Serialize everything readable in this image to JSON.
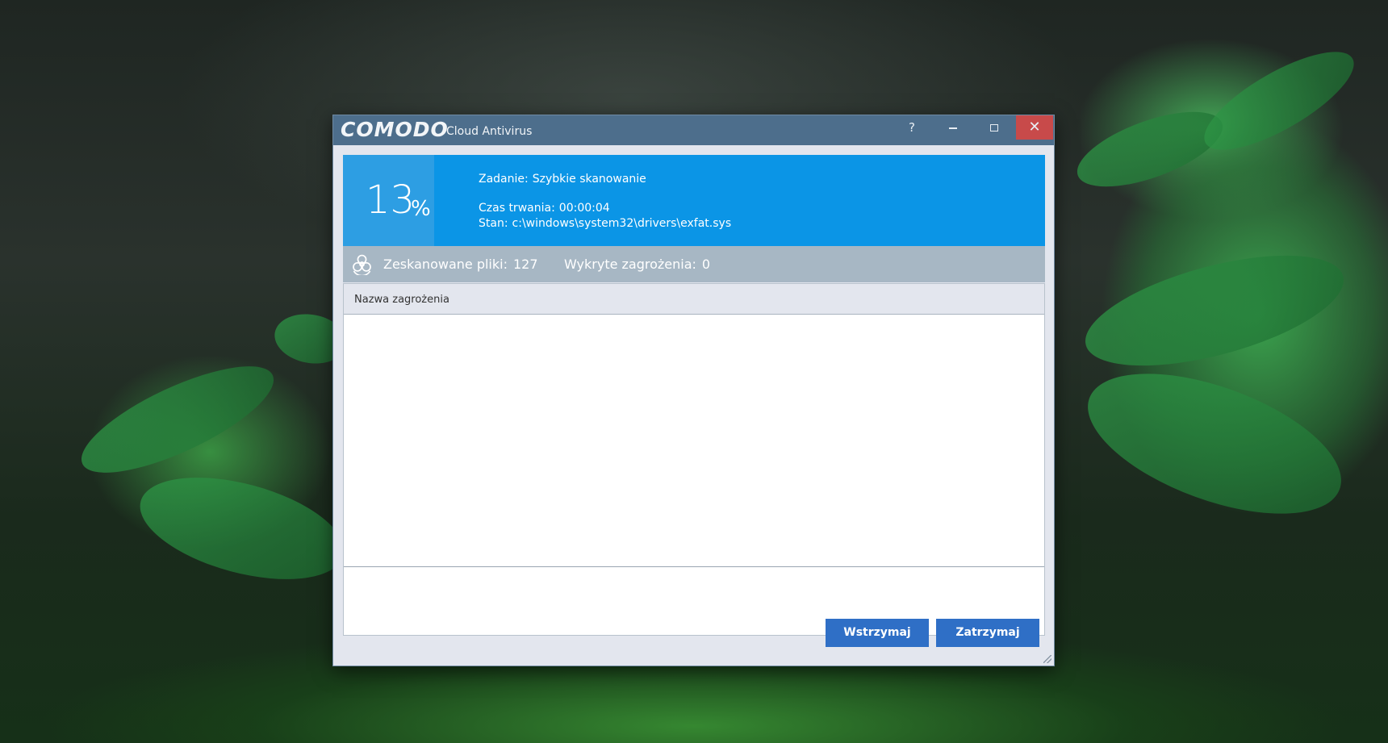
{
  "window": {
    "brand": "COMODO",
    "product": "Cloud Antivirus",
    "controls": {
      "help": "?",
      "close": "✕"
    }
  },
  "scan": {
    "percent_value": "13",
    "percent_sign": "%",
    "progress_fraction": 0.13,
    "task_label": "Zadanie:",
    "task_value": "Szybkie skanowanie",
    "duration_label": "Czas trwania:",
    "duration_value": "00:00:04",
    "status_label": "Stan:",
    "status_value": "c:\\windows\\system32\\drivers\\exfat.sys"
  },
  "stats": {
    "scanned_label": "Zeskanowane pliki:",
    "scanned_value": "127",
    "threats_label": "Wykryte zagrożenia:",
    "threats_value": "0"
  },
  "threat_list": {
    "column_threat_name": "Nazwa zagrożenia",
    "rows": []
  },
  "buttons": {
    "pause": "Wstrzymaj",
    "stop": "Zatrzymaj"
  },
  "colors": {
    "titlebar": "#4d6e8c",
    "progress_panel": "#0b95e6",
    "percent_box": "#2d9ee3",
    "stats_bar": "#a7b7c4",
    "button": "#2f6fc6",
    "close_button": "#c84a4a"
  },
  "icons": {
    "stats": "biohazard-icon"
  }
}
